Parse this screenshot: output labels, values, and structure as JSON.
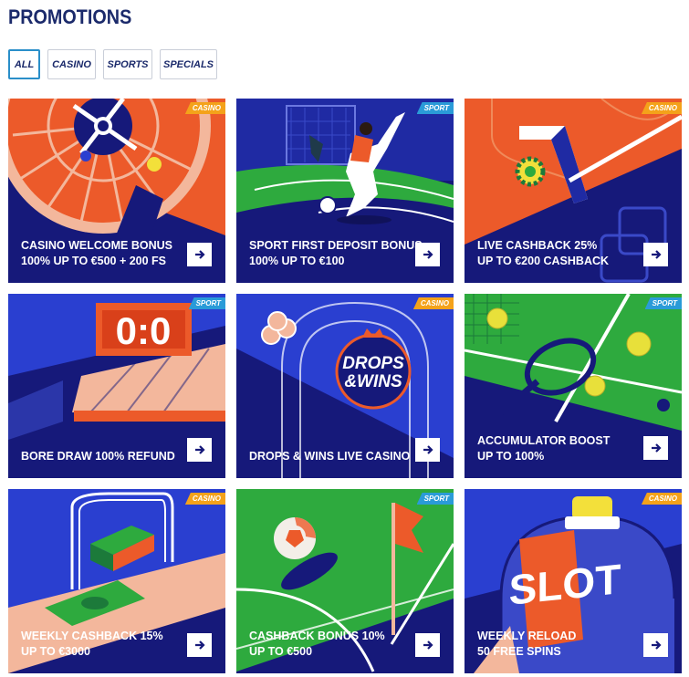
{
  "page": {
    "title": "PROMOTIONS"
  },
  "filters": [
    {
      "label": "ALL",
      "active": true
    },
    {
      "label": "CASINO",
      "active": false
    },
    {
      "label": "SPORTS",
      "active": false
    },
    {
      "label": "SPECIALS",
      "active": false
    }
  ],
  "cards": [
    {
      "badge": "CASINO",
      "line1": "CASINO WELCOME BONUS",
      "line2": "100% UP TO €500 + 200 FS"
    },
    {
      "badge": "SPORT",
      "line1": "SPORT FIRST DEPOSIT BONUS",
      "line2": "100% UP TO €100"
    },
    {
      "badge": "CASINO",
      "line1": "LIVE CASHBACK 25%",
      "line2": "UP TO €200 CASHBACK"
    },
    {
      "badge": "SPORT",
      "line1": "BORE DRAW 100% REFUND",
      "line2": ""
    },
    {
      "badge": "CASINO",
      "line1": "DROPS & WINS LIVE CASINO",
      "line2": ""
    },
    {
      "badge": "SPORT",
      "line1": "ACCUMULATOR BOOST",
      "line2": "UP TO 100%"
    },
    {
      "badge": "CASINO",
      "line1": "WEEKLY CASHBACK 15%",
      "line2": "UP TO €3000"
    },
    {
      "badge": "SPORT",
      "line1": "CASHBACK BONUS 10%",
      "line2": "UP TO €500"
    },
    {
      "badge": "CASINO",
      "line1": "WEEKLY RELOAD",
      "line2": "50 FREE SPINS"
    }
  ],
  "artwork": {
    "scoreboard": "0:0",
    "drops_logo_line1": "DROPS",
    "drops_logo_line2": "&WINS",
    "slot_sign": "SLOT"
  },
  "colors": {
    "navy": "#16197a",
    "title": "#1b2a6b",
    "casino_badge": "#f4a21a",
    "sport_badge": "#2a9bd8",
    "accent_orange": "#ec5a2a",
    "pitch_green": "#2eaa3e"
  },
  "icons": {
    "card_button": "arrow-right-icon"
  }
}
